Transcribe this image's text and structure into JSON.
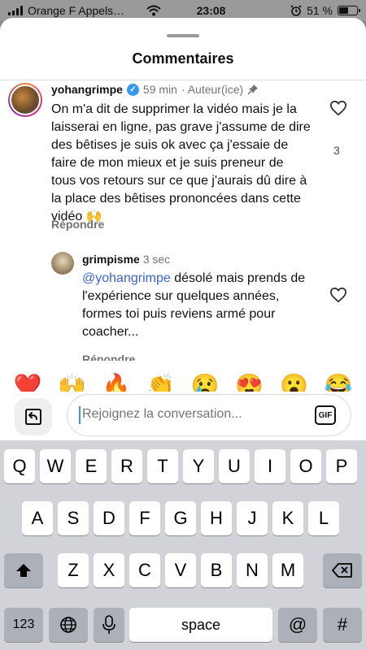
{
  "status_bar": {
    "carrier": "Orange F Appels…",
    "time": "23:08",
    "battery": "51 %",
    "battery_level": 0.51
  },
  "sheet": {
    "title": "Commentaires"
  },
  "comment": {
    "username": "yohangrimpe",
    "time": "59 min",
    "role": "· Auteur(ice)",
    "text": "On m'a dit de supprimer la vidéo mais je la laisserai en ligne, pas grave j'assume de dire des bêtises je suis ok avec ça j'essaie de faire de mon mieux et je suis preneur de tous vos retours sur ce que j'aurais dû dire à la place des bêtises prononcées dans cette vidéo 🙌",
    "likes": "3",
    "reply_label": "Répondre"
  },
  "reply": {
    "username": "grimpisme",
    "time": "3 sec",
    "mention": "@yohangrimpe",
    "text": " désolé mais prends de l'expérience sur quelques années, formes toi puis reviens armé pour coacher...",
    "reply_label": "Répondre"
  },
  "emojis": [
    "❤️",
    "🙌",
    "🔥",
    "👏",
    "😢",
    "😍",
    "😮",
    "😂"
  ],
  "composer": {
    "placeholder": "Rejoignez la conversation...",
    "gif_label": "GIF"
  },
  "keyboard": {
    "row1": [
      "Q",
      "W",
      "E",
      "R",
      "T",
      "Y",
      "U",
      "I",
      "O",
      "P"
    ],
    "row2": [
      "A",
      "S",
      "D",
      "F",
      "G",
      "H",
      "J",
      "K",
      "L"
    ],
    "row3": [
      "Z",
      "X",
      "C",
      "V",
      "B",
      "N",
      "M"
    ],
    "numbers_label": "123",
    "space_label": "space",
    "at_label": "@",
    "hash_label": "#"
  }
}
